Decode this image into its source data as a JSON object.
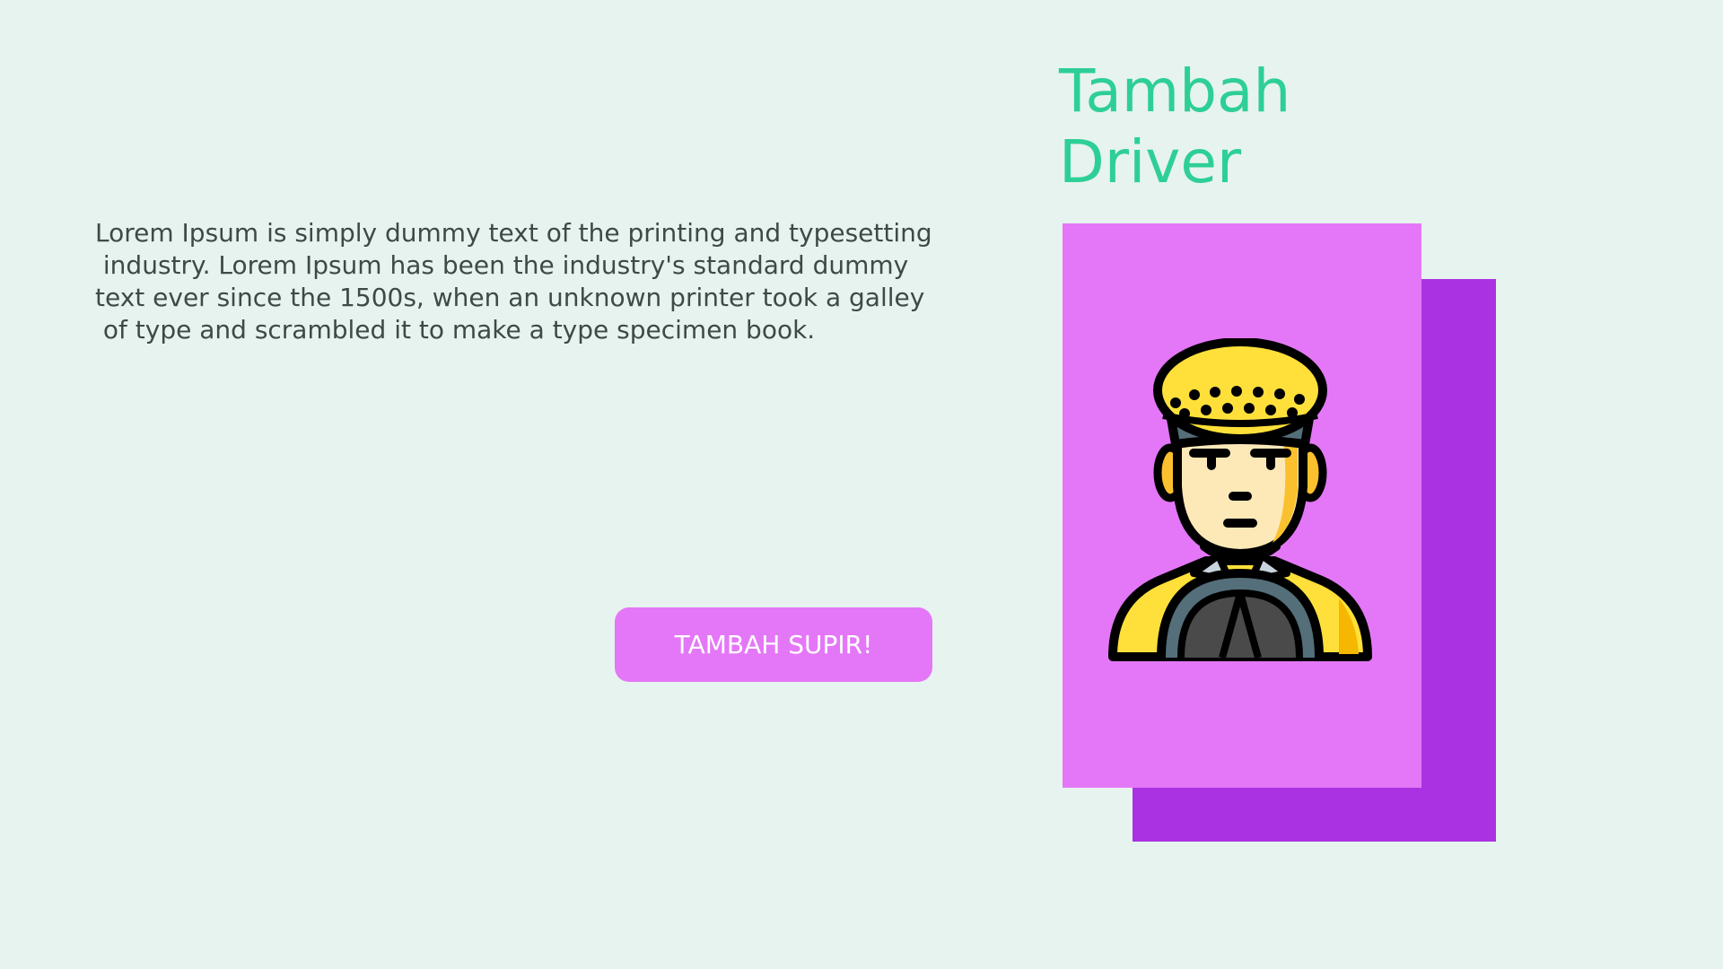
{
  "header": {
    "title_line1": "Tambah",
    "title_line2": "Driver"
  },
  "main": {
    "description_lines": [
      "Lorem Ipsum is simply dummy text of the printing and typesetting",
      " industry. Lorem Ipsum has been the industry's standard dummy",
      "text ever since the 1500s, when an unknown printer took a galley",
      " of type and scrambled it to make a type specimen book."
    ],
    "cta_label": "TAMBAH SUPIR!"
  },
  "illustration": {
    "icon": "taxi-driver-icon"
  },
  "colors": {
    "background": "#e7f3ef",
    "title": "#2ecf96",
    "button": "#e477f7",
    "card_front": "#e477f7",
    "card_back": "#ab32e3",
    "hat_yellow": "#ffe03a",
    "skin": "#fde9b8"
  }
}
